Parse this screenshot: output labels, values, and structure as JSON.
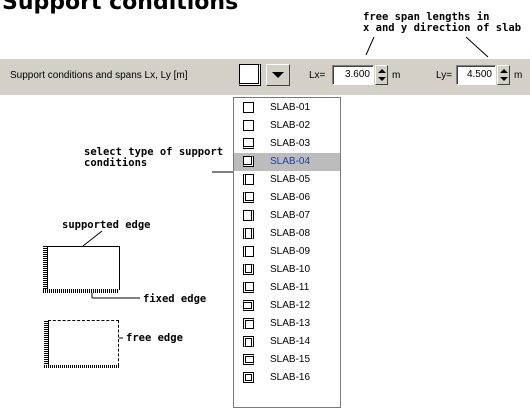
{
  "title": "Support conditions",
  "annotations": {
    "span_note": "free span lengths in\nx and y direction of slab",
    "select_note": "select type of support\nconditions",
    "supported_edge": "supported edge",
    "fixed_edge": "fixed edge",
    "free_edge": "free edge"
  },
  "toolbar": {
    "label": "Support conditions and spans Lx, Ly [m]",
    "lx_label": "Lx=",
    "lx_value": "3.600",
    "lx_unit": "m",
    "ly_label": "Ly=",
    "ly_value": "4.500",
    "ly_unit": "m"
  },
  "dropdown": {
    "selected": "SLAB-04",
    "items": [
      "SLAB-01",
      "SLAB-02",
      "SLAB-03",
      "SLAB-04",
      "SLAB-05",
      "SLAB-06",
      "SLAB-07",
      "SLAB-08",
      "SLAB-09",
      "SLAB-10",
      "SLAB-11",
      "SLAB-12",
      "SLAB-13",
      "SLAB-14",
      "SLAB-15",
      "SLAB-16"
    ]
  }
}
